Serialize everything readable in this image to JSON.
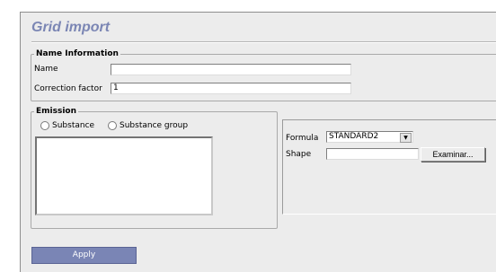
{
  "page": {
    "title": "Grid import"
  },
  "name_information": {
    "legend": "Name Information",
    "name_label": "Name",
    "name_value": "",
    "correction_label": "Correction factor",
    "correction_value": "1"
  },
  "emission": {
    "legend": "Emission",
    "radio_substance": "Substance",
    "radio_substance_group": "Substance group",
    "formula_label": "Formula",
    "formula_value": "STANDARD2",
    "shape_label": "Shape",
    "shape_value": "",
    "browse_label": "Examinar..."
  },
  "actions": {
    "apply_label": "Apply"
  },
  "colors": {
    "title": "#7b86b4",
    "apply_bg": "#7a85b5",
    "panel_bg": "#ececec"
  }
}
